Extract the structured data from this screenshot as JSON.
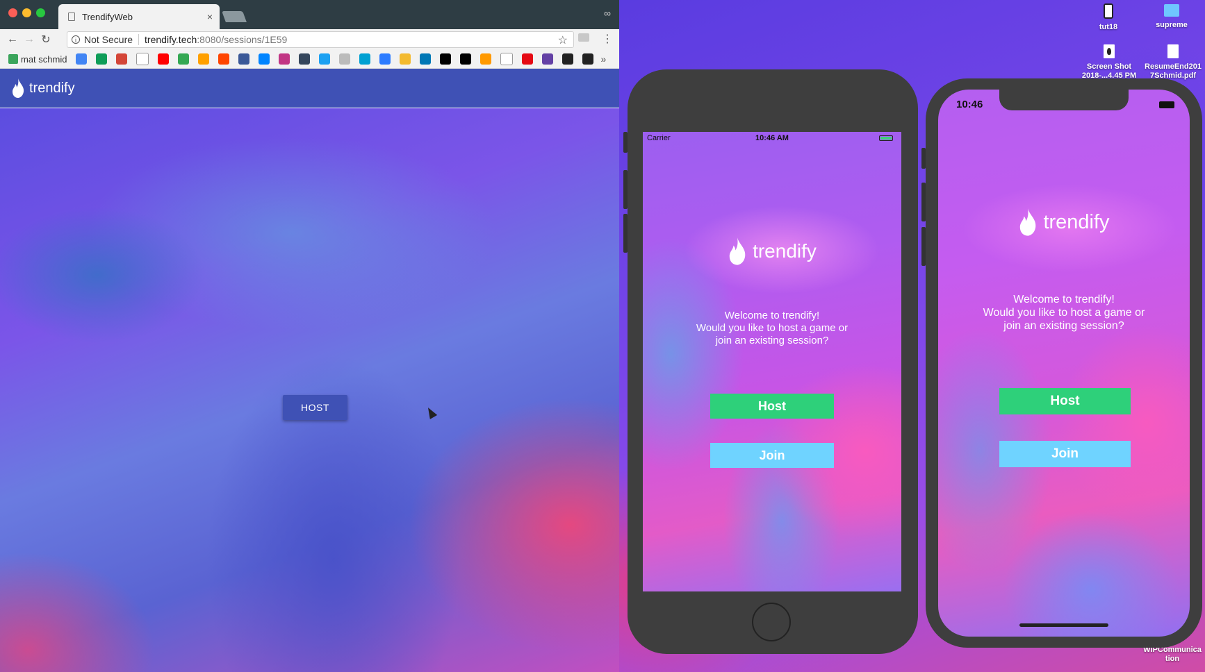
{
  "browser": {
    "tab_title": "TrendifyWeb",
    "tab_close": "×",
    "address": {
      "security": "Not Secure",
      "host": "trendify.tech",
      "path": ":8080/sessions/1E59"
    },
    "bookmarks": {
      "first_label": "mat schmid",
      "more": "»",
      "icons": [
        "google",
        "drive",
        "gmail",
        "page",
        "youtube",
        "maps",
        "firebase",
        "reddit",
        "facebook",
        "messenger",
        "instagram",
        "tumblr",
        "twitter",
        "leaf",
        "sync",
        "fire",
        "binance",
        "linkedin",
        "medium",
        "r",
        "amazon",
        "page",
        "netflix",
        "twitch",
        "g",
        "github"
      ],
      "colors": [
        "#4285f4",
        "#0f9d58",
        "#d44638",
        "#ffffff",
        "#ff0000",
        "#34a853",
        "#ffa000",
        "#ff4500",
        "#3b5998",
        "#0084ff",
        "#c13584",
        "#35465c",
        "#1da1f2",
        "#bbbbbb",
        "#00a0d2",
        "#2b7bff",
        "#f3ba2f",
        "#0077b5",
        "#000000",
        "#000000",
        "#ff9900",
        "#ffffff",
        "#e50914",
        "#6441a5",
        "#222222",
        "#222222"
      ]
    }
  },
  "web_app": {
    "title": "trendify",
    "host_button": "HOST"
  },
  "desktop": {
    "items": [
      {
        "label": "tut18",
        "icon": "phone-file-icon"
      },
      {
        "label": "supreme",
        "icon": "folder-icon"
      },
      {
        "label": "Screen Shot 2018-...4.45 PM",
        "icon": "screenshot-file-icon"
      },
      {
        "label": "ResumeEnd201 7Schmid.pdf",
        "icon": "pdf-file-icon"
      },
      {
        "label": "WIPCommunica tion",
        "icon": "file-icon"
      }
    ]
  },
  "iphone8": {
    "carrier": "Carrier",
    "time": "10:46 AM",
    "brand": "trendify",
    "welcome_lines": [
      "Welcome to trendify!",
      "Would you like to host a game or",
      "join an existing session?"
    ],
    "host": "Host",
    "join": "Join"
  },
  "iphoneX": {
    "time": "10:46",
    "brand": "trendify",
    "welcome_lines": [
      "Welcome to trendify!",
      "Would you like to host a game or",
      "join an existing session?"
    ],
    "host": "Host",
    "join": "Join"
  }
}
